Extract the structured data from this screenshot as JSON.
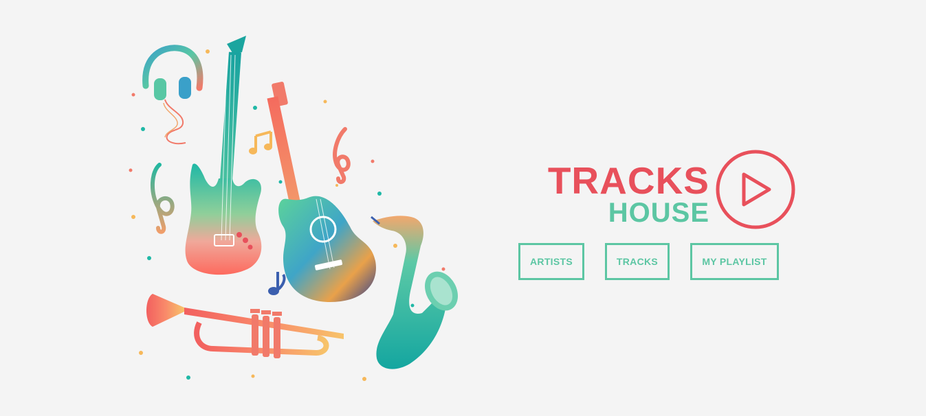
{
  "brand": {
    "line1": "TRACKS",
    "line2": "HOUSE",
    "logo_icon": "play-circle-icon",
    "color_primary": "#e8505b",
    "color_secondary": "#5cc6a3"
  },
  "nav": {
    "items": [
      {
        "label": "ARTISTS",
        "icon": null
      },
      {
        "label": "TRACKS",
        "icon": null
      },
      {
        "label": "MY PLAYLIST",
        "icon": null
      }
    ],
    "accent_color": "#5cc6a3"
  },
  "hero": {
    "illustration": "colorful-music-instruments",
    "elements": [
      "headphones-icon",
      "electric-guitar-icon",
      "acoustic-guitar-icon",
      "treble-clef-icon",
      "music-note-icon",
      "trumpet-icon",
      "saxophone-icon"
    ]
  },
  "background_color": "#f4f4f4"
}
